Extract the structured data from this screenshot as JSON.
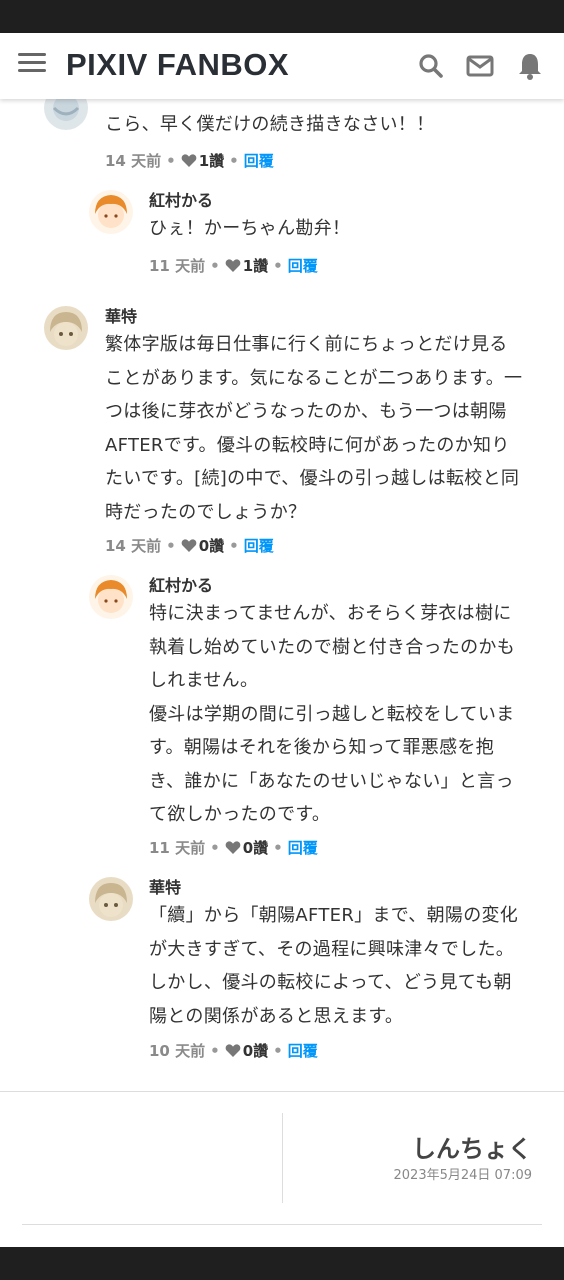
{
  "app": {
    "brand": "PIXIV FANBOX"
  },
  "colors": {
    "accent": "#0096fa",
    "text": "#333333",
    "meta": "#8a8a8a"
  },
  "comments": [
    {
      "author": "",
      "avatar": "no-image-avatar",
      "text": "こら、早く僕だけの続き描きなさい！！",
      "time": "14 天前",
      "likes": "1讚",
      "reply": "回覆"
    },
    {
      "author": "紅村かる",
      "avatar": "orange-hair-avatar",
      "text": "ひぇ！かーちゃん勘弁！",
      "time": "11 天前",
      "likes": "1讚",
      "reply": "回覆"
    },
    {
      "author": "華特",
      "avatar": "beige-face-avatar",
      "text": "繁体字版は毎日仕事に行く前にちょっとだけ見ることがあります。気になることが二つあります。一つは後に芽衣がどうなったのか、もう一つは朝陽AFTERです。優斗の転校時に何があったのか知りたいです。[続]の中で、優斗の引っ越しは転校と同時だったのでしょうか？",
      "time": "14 天前",
      "likes": "0讚",
      "reply": "回覆"
    },
    {
      "author": "紅村かる",
      "avatar": "orange-hair-avatar",
      "text": "特に決まってませんが、おそらく芽衣は樹に執着し始めていたので樹と付き合ったのかもしれません。\n優斗は学期の間に引っ越しと転校をしています。朝陽はそれを後から知って罪悪感を抱き、誰かに「あなたのせいじゃない」と言って欲しかったのです。",
      "time": "11 天前",
      "likes": "0讚",
      "reply": "回覆"
    },
    {
      "author": "華特",
      "avatar": "beige-face-avatar",
      "text": "「續」から「朝陽AFTER」まで、朝陽の変化が大きすぎて、その過程に興味津々でした。しかし、優斗の転校によって、どう見ても朝陽との関係があると思えます。",
      "time": "10 天前",
      "likes": "0讚",
      "reply": "回覆"
    }
  ],
  "next_post": {
    "title": "しんちょく",
    "date": "2023年5月24日 07:09"
  }
}
